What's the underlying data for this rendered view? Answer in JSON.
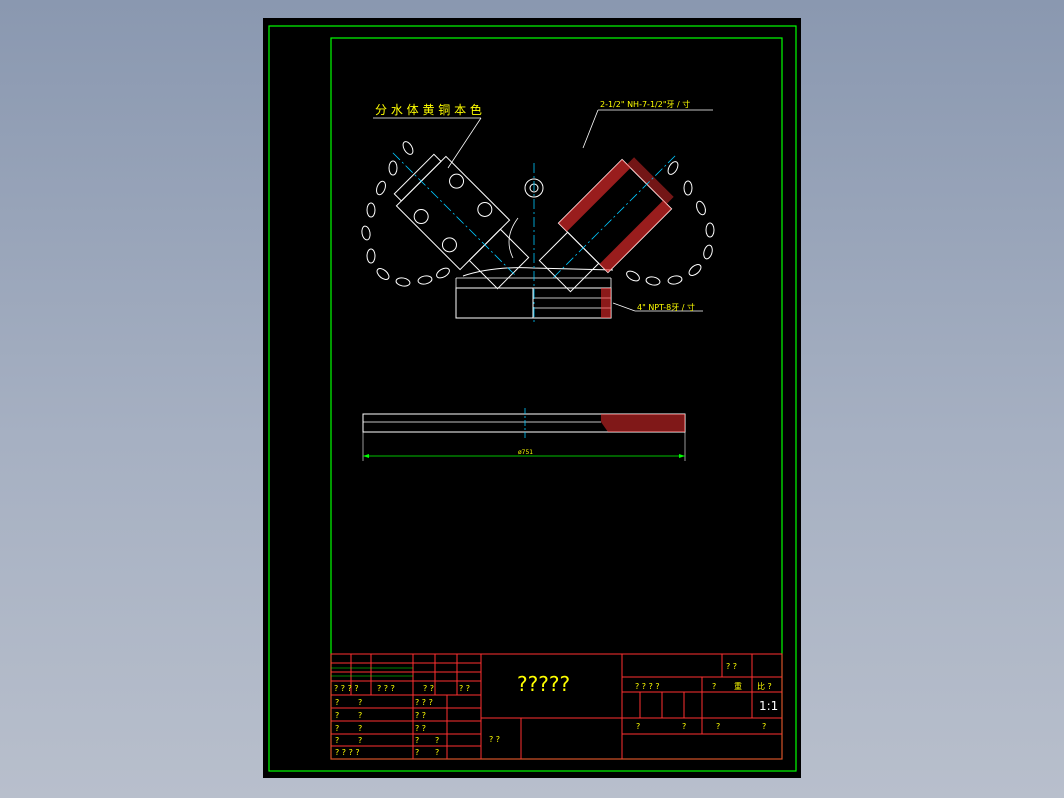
{
  "drawing": {
    "callout_material": "分 水 体 黄 铜 本 色",
    "callout_thread_top": "2-1/2\" NH-7-1/2\"牙 / 寸",
    "callout_thread_bottom": "4\" NPT-8牙 / 寸",
    "dimension_plate": "ø751"
  },
  "title_block": {
    "title": "?????",
    "left_header": [
      "? ? ? ?",
      "? ? ?",
      "? ?",
      "? ?"
    ],
    "left_rows": [
      [
        "?",
        "?",
        "? ? ?"
      ],
      [
        "?",
        "?",
        "? ?"
      ],
      [
        "?",
        "?",
        "? ?"
      ],
      [
        "?",
        "?",
        "?",
        "?"
      ],
      [
        "? ? ? ?",
        "?",
        "?"
      ]
    ],
    "mid_label": "? ?",
    "right_top": "? ?",
    "right_header_a": "? ? ? ?",
    "right_header_b": "?",
    "right_header_c": "重",
    "right_header_d": "比 ?",
    "scale": "1:1",
    "right_bottom": [
      "?",
      "?",
      "?",
      "?"
    ]
  },
  "colors": {
    "border": "#00ff00",
    "geometry": "#ffffff",
    "section": "#ff3030",
    "centerline": "#00c8ff",
    "annotation": "#ffff00",
    "title_lines": "#ff3030"
  }
}
